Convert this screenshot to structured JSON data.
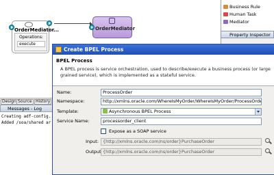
{
  "canvas": {
    "component_title": "OrderMediator...",
    "operations_label": "Operations:",
    "operation_name": "execute",
    "mediator_label": "OrderMediator"
  },
  "palette": {
    "items": [
      {
        "label": "Business Rule",
        "icon": "business-rule-icon"
      },
      {
        "label": "Human Task",
        "icon": "human-task-icon"
      },
      {
        "label": "Mediator",
        "icon": "mediator-icon"
      }
    ],
    "inspector_title": "Property Inspector"
  },
  "log": {
    "tabs": [
      "Design",
      "Source",
      "History"
    ],
    "title": "Messages - Log",
    "lines": [
      "Creating adf-config.",
      "Added /soa/shared ar"
    ]
  },
  "dialog": {
    "title": "Create BPEL Process",
    "section_title": "BPEL Process",
    "description": "A BPEL process is service orchestration, used to describe/execute a business process (or large grained service), which is implemented as a stateful service.",
    "name_label": "Name:",
    "name_value": "ProcessOrder",
    "namespace_label": "Namespace:",
    "namespace_value": "http://xmlns.oracle.com/WhereIsMyOrder/WhereIsMyOrder/ProcessOrder",
    "template_label": "Template:",
    "template_value": "Asynchronous BPEL Process",
    "service_name_label": "Service Name:",
    "service_name_value": "processorder_client",
    "expose_label": "Expose as a SOAP service",
    "input_label": "Input:",
    "input_value": "{http://xmlns.oracle.com/ns/order}PurchaseOrder",
    "output_label": "Output:",
    "output_value": "{http://xmlns.oracle.com/ns/order}PurchaseOrder"
  },
  "colors": {
    "titlebar": "#2a5fc9",
    "mediator_fill": "#c9b2e6",
    "pin": "#27a7c9"
  }
}
